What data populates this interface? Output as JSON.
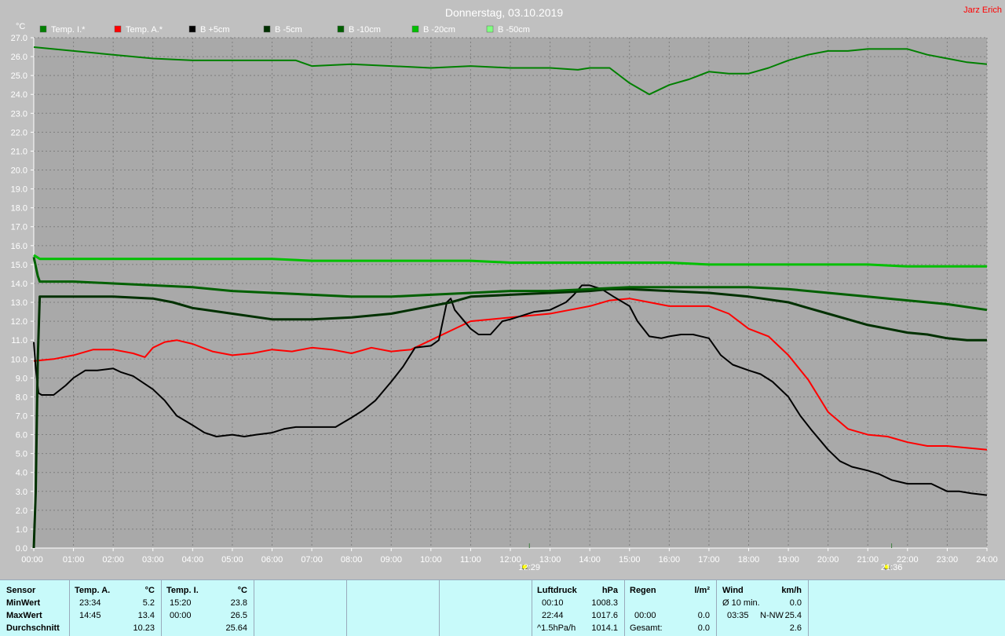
{
  "header": {
    "title": "Donnerstag, 03.10.2019",
    "author": "Jarz Erich"
  },
  "colors": {
    "background": "#c0c0c0",
    "plot_background": "#a9a9a9",
    "grid": "#7f7f7f",
    "stats_panel": "#c8fafa",
    "author_text": "#ff0000"
  },
  "chart_data": {
    "type": "line",
    "ylabel": "°C",
    "ylim": [
      0,
      27
    ],
    "yticks": [
      "0.0",
      "1.0",
      "2.0",
      "3.0",
      "4.0",
      "5.0",
      "6.0",
      "7.0",
      "8.0",
      "9.0",
      "10.0",
      "11.0",
      "12.0",
      "13.0",
      "14.0",
      "15.0",
      "16.0",
      "17.0",
      "18.0",
      "19.0",
      "20.0",
      "21.0",
      "22.0",
      "23.0",
      "24.0",
      "25.0",
      "26.0",
      "27.0"
    ],
    "xlim": [
      0,
      24
    ],
    "xticks": [
      "00:00",
      "01:00",
      "02:00",
      "03:00",
      "04:00",
      "05:00",
      "06:00",
      "07:00",
      "08:00",
      "09:00",
      "10:00",
      "11:00",
      "12:00",
      "13:00",
      "14:00",
      "15:00",
      "16:00",
      "17:00",
      "18:00",
      "19:00",
      "20:00",
      "21:00",
      "22:00",
      "23:00",
      "24:00"
    ],
    "grid": true,
    "legend_position": "top",
    "markers": [
      {
        "label": "12:29",
        "x": 12.48,
        "icon": "sunrise-icon"
      },
      {
        "label": "21:36",
        "x": 21.6,
        "icon": "sunset-icon"
      }
    ],
    "series": [
      {
        "name": "Temp. I.*",
        "color": "#008000",
        "width": 2,
        "x": [
          0,
          1,
          2,
          3,
          4,
          5,
          6,
          6.6,
          7,
          8,
          9,
          10,
          11,
          12,
          13,
          13.7,
          14,
          14.5,
          15,
          15.5,
          16,
          16.5,
          17,
          17.5,
          18,
          18.5,
          19,
          19.5,
          20,
          20.5,
          21,
          21.5,
          22,
          22.5,
          23,
          23.5,
          24
        ],
        "y": [
          26.5,
          26.3,
          26.1,
          25.9,
          25.8,
          25.8,
          25.8,
          25.8,
          25.5,
          25.6,
          25.5,
          25.4,
          25.5,
          25.4,
          25.4,
          25.3,
          25.4,
          25.4,
          24.6,
          24.0,
          24.5,
          24.8,
          25.2,
          25.1,
          25.1,
          25.4,
          25.8,
          26.1,
          26.3,
          26.3,
          26.4,
          26.4,
          26.4,
          26.1,
          25.9,
          25.7,
          25.6
        ]
      },
      {
        "name": "Temp. A.*",
        "color": "#ff0000",
        "width": 2,
        "x": [
          0,
          0.5,
          1,
          1.5,
          2,
          2.5,
          2.8,
          3,
          3.3,
          3.6,
          4,
          4.5,
          5,
          5.5,
          6,
          6.5,
          7,
          7.5,
          8,
          8.5,
          9,
          9.5,
          10,
          10.5,
          11,
          11.5,
          12,
          12.5,
          13,
          13.5,
          14,
          14.5,
          15,
          15.5,
          16,
          16.5,
          17,
          17.5,
          18,
          18.5,
          19,
          19.5,
          20,
          20.5,
          21,
          21.5,
          22,
          22.5,
          23,
          23.5,
          24
        ],
        "y": [
          9.9,
          10.0,
          10.2,
          10.5,
          10.5,
          10.3,
          10.1,
          10.6,
          10.9,
          11.0,
          10.8,
          10.4,
          10.2,
          10.3,
          10.5,
          10.4,
          10.6,
          10.5,
          10.3,
          10.6,
          10.4,
          10.5,
          11.0,
          11.5,
          12.0,
          12.1,
          12.2,
          12.3,
          12.4,
          12.6,
          12.8,
          13.1,
          13.2,
          13.0,
          12.8,
          12.8,
          12.8,
          12.4,
          11.6,
          11.2,
          10.2,
          8.9,
          7.2,
          6.3,
          6.0,
          5.9,
          5.6,
          5.4,
          5.4,
          5.3,
          5.2
        ]
      },
      {
        "name": "B +5cm",
        "color": "#000000",
        "width": 2,
        "x": [
          0,
          0.05,
          0.12,
          0.2,
          0.5,
          0.8,
          1,
          1.3,
          1.6,
          2,
          2.2,
          2.5,
          3,
          3.3,
          3.6,
          4,
          4.3,
          4.6,
          5,
          5.3,
          5.6,
          6,
          6.3,
          6.6,
          7,
          7.3,
          7.6,
          8,
          8.3,
          8.6,
          9,
          9.3,
          9.6,
          10,
          10.2,
          10.3,
          10.4,
          10.5,
          10.6,
          10.8,
          11,
          11.2,
          11.5,
          11.8,
          12,
          12.3,
          12.6,
          13,
          13.4,
          13.6,
          13.8,
          14,
          14.3,
          14.6,
          15,
          15.2,
          15.5,
          15.8,
          16,
          16.3,
          16.6,
          17,
          17.3,
          17.6,
          18,
          18.3,
          18.6,
          19,
          19.3,
          19.6,
          20,
          20.3,
          20.6,
          21,
          21.3,
          21.6,
          22,
          22.3,
          22.6,
          23,
          23.3,
          23.6,
          24
        ],
        "y": [
          10.9,
          9.5,
          8.2,
          8.1,
          8.1,
          8.6,
          9.0,
          9.4,
          9.4,
          9.5,
          9.3,
          9.1,
          8.4,
          7.8,
          7.0,
          6.5,
          6.1,
          5.9,
          6.0,
          5.9,
          6.0,
          6.1,
          6.3,
          6.4,
          6.4,
          6.4,
          6.4,
          6.9,
          7.3,
          7.8,
          8.8,
          9.6,
          10.6,
          10.7,
          11.0,
          12.0,
          13.0,
          13.2,
          12.6,
          12.1,
          11.6,
          11.3,
          11.3,
          12.0,
          12.1,
          12.3,
          12.5,
          12.6,
          13.0,
          13.4,
          13.9,
          13.9,
          13.7,
          13.3,
          12.8,
          12.0,
          11.2,
          11.1,
          11.2,
          11.3,
          11.3,
          11.1,
          10.2,
          9.7,
          9.4,
          9.2,
          8.8,
          8.0,
          7.0,
          6.2,
          5.2,
          4.6,
          4.3,
          4.1,
          3.9,
          3.6,
          3.4,
          3.4,
          3.4,
          3.0,
          3.0,
          2.9,
          2.8
        ]
      },
      {
        "name": "B -5cm",
        "color": "#003000",
        "width": 3,
        "x": [
          0,
          0.05,
          0.1,
          0.15,
          0.3,
          1,
          2,
          3,
          3.5,
          4,
          5,
          6,
          7,
          8,
          9,
          9.5,
          10,
          10.5,
          11,
          12,
          13,
          14,
          14.5,
          15,
          16,
          17,
          18,
          19,
          19.5,
          20,
          20.5,
          21,
          21.5,
          22,
          22.5,
          23,
          23.5,
          24
        ],
        "y": [
          0,
          3,
          10,
          13.3,
          13.3,
          13.3,
          13.3,
          13.2,
          13.0,
          12.7,
          12.4,
          12.1,
          12.1,
          12.2,
          12.4,
          12.6,
          12.8,
          13.0,
          13.3,
          13.4,
          13.5,
          13.6,
          13.7,
          13.7,
          13.6,
          13.5,
          13.3,
          13.0,
          12.7,
          12.4,
          12.1,
          11.8,
          11.6,
          11.4,
          11.3,
          11.1,
          11.0,
          11.0
        ]
      },
      {
        "name": "B -10cm",
        "color": "#006000",
        "width": 3,
        "x": [
          0,
          0.1,
          0.15,
          0.3,
          1,
          2,
          3,
          4,
          5,
          6,
          7,
          8,
          9,
          10,
          11,
          12,
          13,
          14,
          15,
          16,
          17,
          18,
          19,
          20,
          21,
          22,
          23,
          24
        ],
        "y": [
          15.4,
          14.4,
          14.1,
          14.1,
          14.1,
          14.0,
          13.9,
          13.8,
          13.6,
          13.5,
          13.4,
          13.3,
          13.3,
          13.4,
          13.5,
          13.6,
          13.6,
          13.7,
          13.8,
          13.8,
          13.8,
          13.8,
          13.7,
          13.5,
          13.3,
          13.1,
          12.9,
          12.6
        ]
      },
      {
        "name": "B -20cm",
        "color": "#00c000",
        "width": 3,
        "x": [
          0,
          0.15,
          0.3,
          1,
          2,
          3,
          4,
          5,
          6,
          7,
          8,
          9,
          10,
          11,
          12,
          13,
          14,
          15,
          16,
          17,
          18,
          19,
          20,
          21,
          22,
          23,
          24
        ],
        "y": [
          15.5,
          15.3,
          15.3,
          15.3,
          15.3,
          15.3,
          15.3,
          15.3,
          15.3,
          15.2,
          15.2,
          15.2,
          15.2,
          15.2,
          15.1,
          15.1,
          15.1,
          15.1,
          15.1,
          15.0,
          15.0,
          15.0,
          15.0,
          15.0,
          14.9,
          14.9,
          14.9
        ]
      },
      {
        "name": "B -50cm",
        "color": "#80ff80",
        "width": 2,
        "x": [],
        "y": []
      }
    ]
  },
  "stats": {
    "sensor": {
      "header": "Sensor",
      "rows": [
        "MinWert",
        "MaxWert",
        "Durchschnitt"
      ]
    },
    "temp_a": {
      "header": "Temp. A.",
      "unit": "°C",
      "min_time": "23:34",
      "min_val": "5.2",
      "max_time": "14:45",
      "max_val": "13.4",
      "avg": "10.23"
    },
    "temp_i": {
      "header": "Temp. I.",
      "unit": "°C",
      "min_time": "15:20",
      "min_val": "23.8",
      "max_time": "00:00",
      "max_val": "26.5",
      "avg": "25.64"
    },
    "pressure": {
      "header": "Luftdruck",
      "unit": "hPa",
      "min_time": "00:10",
      "min_val": "1008.3",
      "max_time": "22:44",
      "max_val": "1017.6",
      "trend_label": "^1.5hPa/h",
      "trend_val": "1014.1"
    },
    "rain": {
      "header": "Regen",
      "unit": "l/m²",
      "row2_time": "00:00",
      "row2_val": "0.0",
      "total_label": "Gesamt:",
      "total_val": "0.0"
    },
    "wind": {
      "header": "Wind",
      "unit": "km/h",
      "row1_label": "Ø 10 min.",
      "row1_val": "0.0",
      "row2_time": "03:35",
      "row2_dir": "N-NW",
      "row2_val": "25.4",
      "avg_val": "2.6"
    }
  }
}
